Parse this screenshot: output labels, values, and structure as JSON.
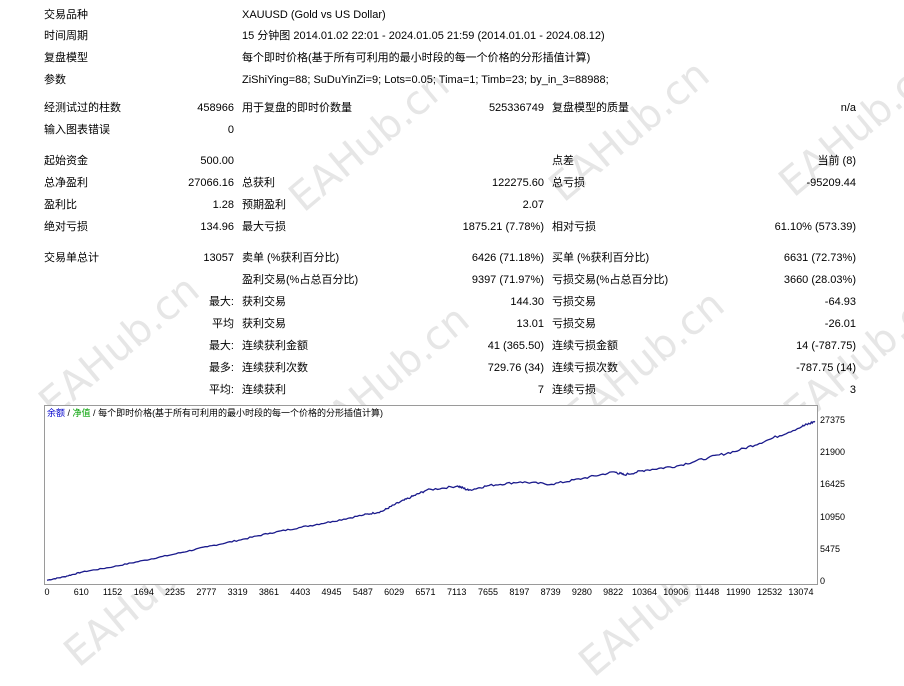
{
  "header": {
    "symbol_label": "交易品种",
    "symbol_value": "XAUUSD (Gold vs US Dollar)",
    "period_label": "时间周期",
    "period_value": "15 分钟图 2014.01.02 22:01 - 2024.01.05 21:59 (2014.01.01 - 2024.08.12)",
    "model_label": "复盘模型",
    "model_value": "每个即时价格(基于所有可利用的最小时段的每一个价格的分形插值计算)",
    "params_label": "参数",
    "params_value": "ZiShiYing=88; SuDuYinZi=9; Lots=0.05; Tima=1; Timb=23; by_in_3=88988;"
  },
  "stats": {
    "bars_label": "经测试过的柱数",
    "bars_value": "458966",
    "ticks_label": "用于复盘的即时价数量",
    "ticks_value": "525336749",
    "quality_label": "复盘模型的质量",
    "quality_value": "n/a",
    "errors_label": "输入图表错误",
    "errors_value": "0",
    "deposit_label": "起始资金",
    "deposit_value": "500.00",
    "spread_label": "点差",
    "spread_value": "当前 (8)",
    "netprofit_label": "总净盈利",
    "netprofit_value": "27066.16",
    "grossprofit_label": "总获利",
    "grossprofit_value": "122275.60",
    "grossloss_label": "总亏损",
    "grossloss_value": "-95209.44",
    "pf_label": "盈利比",
    "pf_value": "1.28",
    "expected_label": "预期盈利",
    "expected_value": "2.07",
    "absdd_label": "绝对亏损",
    "absdd_value": "134.96",
    "maxdd_label": "最大亏损",
    "maxdd_value": "1875.21 (7.78%)",
    "reldd_label": "相对亏损",
    "reldd_value": "61.10% (573.39)",
    "trades_label": "交易单总计",
    "trades_value": "13057",
    "short_label": "卖单 (%获利百分比)",
    "short_value": "6426 (71.18%)",
    "long_label": "买单 (%获利百分比)",
    "long_value": "6631 (72.73%)",
    "profit_trades_label": "盈利交易(%占总百分比)",
    "profit_trades_value": "9397 (71.97%)",
    "loss_trades_label": "亏损交易(%占总百分比)",
    "loss_trades_value": "3660 (28.03%)",
    "largest_prefix": "最大:",
    "largest_profit_label": "获利交易",
    "largest_profit_value": "144.30",
    "largest_loss_label": "亏损交易",
    "largest_loss_value": "-64.93",
    "average_prefix": "平均",
    "average_profit_label": "获利交易",
    "average_profit_value": "13.01",
    "average_loss_label": "亏损交易",
    "average_loss_value": "-26.01",
    "max_prefix": "最大:",
    "max_cons_wins_label": "连续获利金额",
    "max_cons_wins_value": "41 (365.50)",
    "max_cons_losses_label": "连续亏损金额",
    "max_cons_losses_value": "14 (-787.75)",
    "maximal_prefix": "最多:",
    "maximal_cons_profit_label": "连续获利次数",
    "maximal_cons_profit_value": "729.76 (34)",
    "maximal_cons_loss_label": "连续亏损次数",
    "maximal_cons_loss_value": "-787.75 (14)",
    "avg_cons_prefix": "平均:",
    "avg_cons_wins_label": "连续获利",
    "avg_cons_wins_value": "7",
    "avg_cons_losses_label": "连续亏损",
    "avg_cons_losses_value": "3"
  },
  "legend": {
    "balance": "余额",
    "sep1": " / ",
    "equity": "净值",
    "sep2": " / ",
    "model": "每个即时价格(基于所有可利用的最小时段的每一个价格的分形插值计算)"
  },
  "watermark": "EAHub.cn",
  "colors": {
    "balance_line": "#1a1a8c",
    "equity_text": "#00a000",
    "balance_text": "#0000cc",
    "grid": "#9a9a9a"
  },
  "chart_data": {
    "type": "line",
    "y_ticks": [
      "27375",
      "21900",
      "16425",
      "10950",
      "5475",
      "0"
    ],
    "x_ticks": [
      "0",
      "610",
      "1152",
      "1694",
      "2235",
      "2777",
      "3319",
      "3861",
      "4403",
      "4945",
      "5487",
      "6029",
      "6571",
      "7113",
      "7655",
      "8197",
      "8739",
      "9280",
      "9822",
      "10364",
      "10906",
      "11448",
      "11990",
      "12532",
      "13074"
    ],
    "ylim": [
      0,
      28200
    ],
    "xlim": [
      0,
      13300
    ],
    "series": [
      {
        "x": [
          0,
          300,
          610,
          1152,
          1694,
          2235,
          2777,
          3319,
          3861,
          4403,
          4945,
          5487,
          5800,
          6029,
          6300,
          6571,
          7113,
          7300,
          7655,
          8197,
          8739,
          9280,
          9822,
          10000,
          10364,
          10906,
          11448,
          11990,
          12532,
          13074,
          13300
        ],
        "values": [
          300,
          900,
          1700,
          2600,
          3700,
          4800,
          6000,
          7100,
          8300,
          9300,
          10300,
          11400,
          12000,
          13200,
          14400,
          15600,
          16300,
          15600,
          16400,
          17000,
          16600,
          17600,
          18700,
          18200,
          19000,
          19700,
          21100,
          22400,
          24300,
          26400,
          27300
        ]
      }
    ]
  }
}
